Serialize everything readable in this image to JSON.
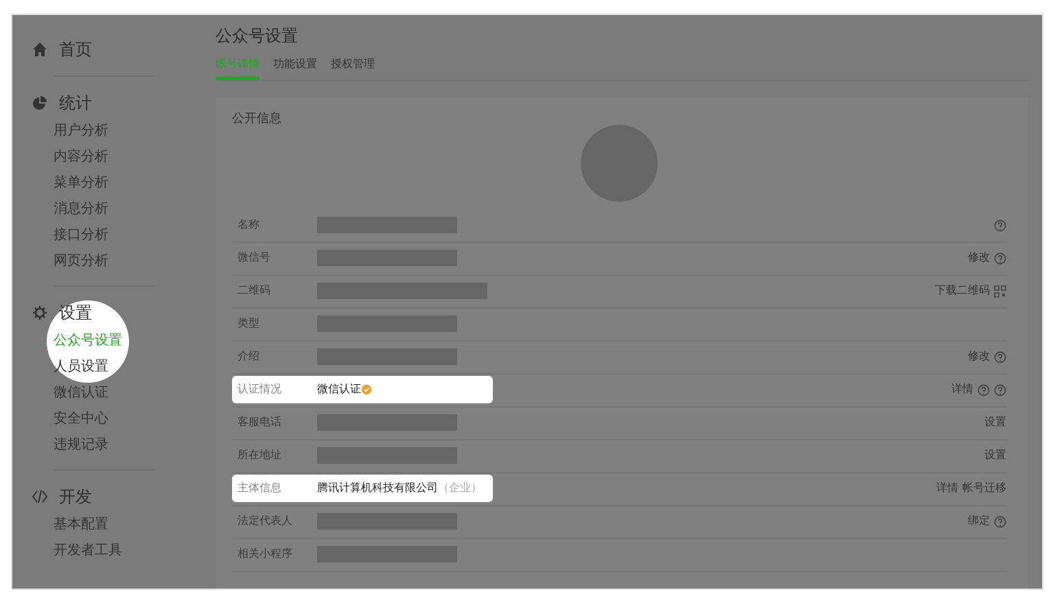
{
  "sidebar": {
    "groups": [
      {
        "title": "首页"
      },
      {
        "title": "统计",
        "items": [
          {
            "label": "用户分析",
            "selected": false,
            "highlighted": false
          },
          {
            "label": "内容分析",
            "selected": false,
            "highlighted": false
          },
          {
            "label": "菜单分析",
            "selected": false,
            "highlighted": false
          },
          {
            "label": "消息分析",
            "selected": false,
            "highlighted": false
          },
          {
            "label": "接口分析",
            "selected": false,
            "highlighted": false
          },
          {
            "label": "网页分析",
            "selected": false,
            "highlighted": false
          }
        ]
      },
      {
        "title": "设置",
        "items": [
          {
            "label": "公众号设置",
            "selected": true,
            "highlighted": true
          },
          {
            "label": "人员设置",
            "selected": false,
            "highlighted": false
          },
          {
            "label": "微信认证",
            "selected": false,
            "highlighted": false
          },
          {
            "label": "安全中心",
            "selected": false,
            "highlighted": false
          },
          {
            "label": "违规记录",
            "selected": false,
            "highlighted": false
          }
        ]
      },
      {
        "title": "开发",
        "items": [
          {
            "label": "基本配置",
            "selected": false,
            "highlighted": false
          },
          {
            "label": "开发者工具",
            "selected": false,
            "highlighted": false
          }
        ]
      }
    ]
  },
  "page_title": "公众号设置",
  "tabs": [
    {
      "label": "帐号详情",
      "selected": true
    },
    {
      "label": "功能设置",
      "selected": false
    },
    {
      "label": "授权管理",
      "selected": false
    }
  ],
  "section_title": "公开信息",
  "rows": [
    {
      "label": "名称",
      "value": {
        "kind": "redacted"
      },
      "highlighted": false,
      "actions": [
        {
          "kind": "help"
        }
      ]
    },
    {
      "label": "微信号",
      "value": {
        "kind": "redacted"
      },
      "highlighted": false,
      "actions": [
        {
          "kind": "link",
          "text": "修改"
        },
        {
          "kind": "help"
        }
      ]
    },
    {
      "label": "二维码",
      "value": {
        "kind": "redacted_wide"
      },
      "highlighted": false,
      "actions": [
        {
          "kind": "link",
          "text": "下载二维码"
        },
        {
          "kind": "qr"
        }
      ]
    },
    {
      "label": "类型",
      "value": {
        "kind": "redacted"
      },
      "highlighted": false,
      "actions": []
    },
    {
      "label": "介绍",
      "value": {
        "kind": "redacted"
      },
      "highlighted": false,
      "actions": [
        {
          "kind": "link",
          "text": "修改"
        },
        {
          "kind": "help"
        }
      ]
    },
    {
      "label": "认证情况",
      "value": {
        "kind": "verified_text",
        "text": "微信认证"
      },
      "highlighted": true,
      "actions": [
        {
          "kind": "link",
          "text": "详情"
        },
        {
          "kind": "help"
        },
        {
          "kind": "help"
        }
      ]
    },
    {
      "label": "客服电话",
      "value": {
        "kind": "redacted"
      },
      "highlighted": false,
      "actions": [
        {
          "kind": "link",
          "text": "设置"
        }
      ]
    },
    {
      "label": "所在地址",
      "value": {
        "kind": "redacted"
      },
      "highlighted": false,
      "actions": [
        {
          "kind": "link",
          "text": "设置"
        }
      ]
    },
    {
      "label": "主体信息",
      "value": {
        "kind": "text",
        "text": "腾讯计算机科技有限公司",
        "note": "（企业）"
      },
      "highlighted": true,
      "actions": [
        {
          "kind": "link",
          "text": "详情"
        },
        {
          "kind": "link",
          "text": "帐号迁移"
        }
      ]
    },
    {
      "label": "法定代表人",
      "value": {
        "kind": "redacted"
      },
      "highlighted": false,
      "actions": [
        {
          "kind": "link",
          "text": "绑定"
        },
        {
          "kind": "help"
        }
      ]
    },
    {
      "label": "相关小程序",
      "value": {
        "kind": "redacted"
      },
      "highlighted": false,
      "actions": []
    }
  ]
}
